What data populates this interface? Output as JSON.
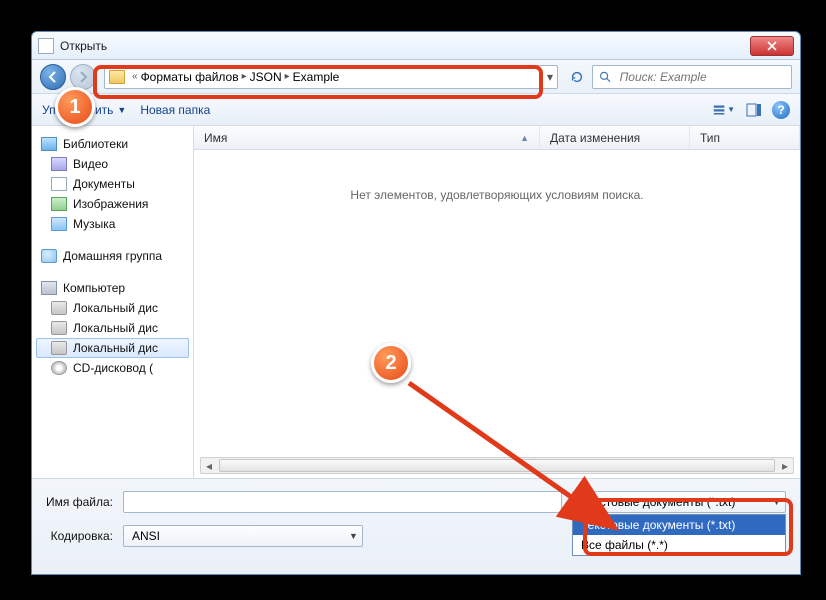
{
  "window": {
    "title": "Открыть"
  },
  "breadcrumb": {
    "back_overflow": "«",
    "segments": [
      "Форматы файлов",
      "JSON",
      "Example"
    ]
  },
  "search": {
    "placeholder": "Поиск: Example"
  },
  "toolbar": {
    "organize": "Упорядочить",
    "new_folder": "Новая папка"
  },
  "sidebar": {
    "libraries_label": "Библиотеки",
    "libraries": [
      "Видео",
      "Документы",
      "Изображения",
      "Музыка"
    ],
    "homegroup": "Домашняя группа",
    "computer_label": "Компьютер",
    "computer": [
      "Локальный дис",
      "Локальный дис",
      "Локальный дис",
      "CD-дисковод ("
    ]
  },
  "columns": {
    "name": "Имя",
    "date": "Дата изменения",
    "type": "Тип"
  },
  "empty_message": "Нет элементов, удовлетворяющих условиям поиска.",
  "filename_label": "Имя файла:",
  "filename_value": "",
  "encoding_label": "Кодировка:",
  "encoding_value": "ANSI",
  "filetype": {
    "selected": "Текстовые документы (*.txt)",
    "options": [
      "Текстовые документы (*.txt)",
      "Все файлы  (*.*)"
    ]
  },
  "callouts": {
    "one": "1",
    "two": "2"
  }
}
